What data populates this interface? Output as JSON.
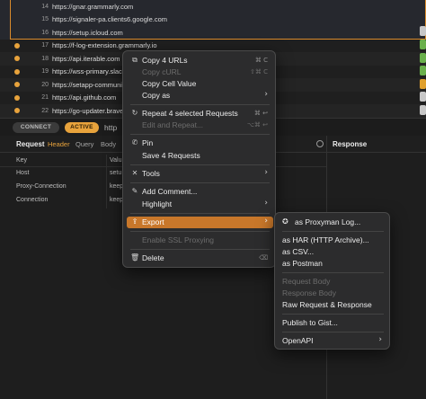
{
  "requests": [
    {
      "num": "14",
      "url": "https://gnar.grammarly.com"
    },
    {
      "num": "15",
      "url": "https://signaler-pa.clients6.google.com"
    },
    {
      "num": "16",
      "url": "https://setup.icloud.com"
    },
    {
      "num": "17",
      "url": "https://f-log-extension.grammarly.io"
    },
    {
      "num": "18",
      "url": "https://api.iterable.com"
    },
    {
      "num": "19",
      "url": "https://wss-primary.slac"
    },
    {
      "num": "20",
      "url": "https://setapp-communi"
    },
    {
      "num": "21",
      "url": "https://api.github.com"
    },
    {
      "num": "22",
      "url": "https://go-updater.brave"
    }
  ],
  "tabbar": {
    "connect": "CONNECT",
    "active": "ACTIVE",
    "http": "http"
  },
  "request_pane": {
    "title": "Request",
    "tabs": [
      "Header",
      "Query",
      "Body"
    ],
    "columns": {
      "key": "Key",
      "value": "Valu"
    },
    "rows": [
      {
        "key": "Host",
        "value": "setu"
      },
      {
        "key": "Proxy-Connection",
        "value": "keep"
      },
      {
        "key": "Connection",
        "value": "keep"
      }
    ]
  },
  "response_pane": {
    "title": "Response"
  },
  "context_menu": {
    "copy_urls": {
      "label": "Copy 4 URLs",
      "shortcut": "⌘ C",
      "icon": "copy-icon"
    },
    "copy_curl": {
      "label": "Copy cURL",
      "shortcut": "⇧⌘ C"
    },
    "copy_cell": {
      "label": "Copy Cell Value"
    },
    "copy_as": {
      "label": "Copy as"
    },
    "repeat": {
      "label": "Repeat 4 selected Requests",
      "shortcut": "⌘ ↩",
      "icon": "repeat-icon"
    },
    "edit_repeat": {
      "label": "Edit and Repeat...",
      "shortcut": "⌥⌘ ↩"
    },
    "pin": {
      "label": "Pin",
      "icon": "pin-icon"
    },
    "save": {
      "label": "Save 4 Requests"
    },
    "tools": {
      "label": "Tools",
      "icon": "tools-icon"
    },
    "add_comment": {
      "label": "Add Comment...",
      "icon": "comment-icon"
    },
    "highlight": {
      "label": "Highlight"
    },
    "export": {
      "label": "Export",
      "icon": "export-icon"
    },
    "ssl": {
      "label": "Enable SSL Proxying"
    },
    "delete": {
      "label": "Delete",
      "shortcut": "⌫",
      "icon": "trash-icon"
    }
  },
  "export_menu": {
    "proxyman_log": "as Proxyman Log...",
    "har": "as HAR (HTTP Archive)...",
    "csv": "as CSV...",
    "postman": "as Postman",
    "req_body": "Request Body",
    "resp_body": "Response Body",
    "raw": "Raw Request & Response",
    "gist": "Publish to Gist...",
    "openapi": "OpenAPI"
  },
  "colors": {
    "accent": "#e8a33c",
    "highlight": "#c8772a",
    "menu_bg": "#2c2c2d"
  }
}
